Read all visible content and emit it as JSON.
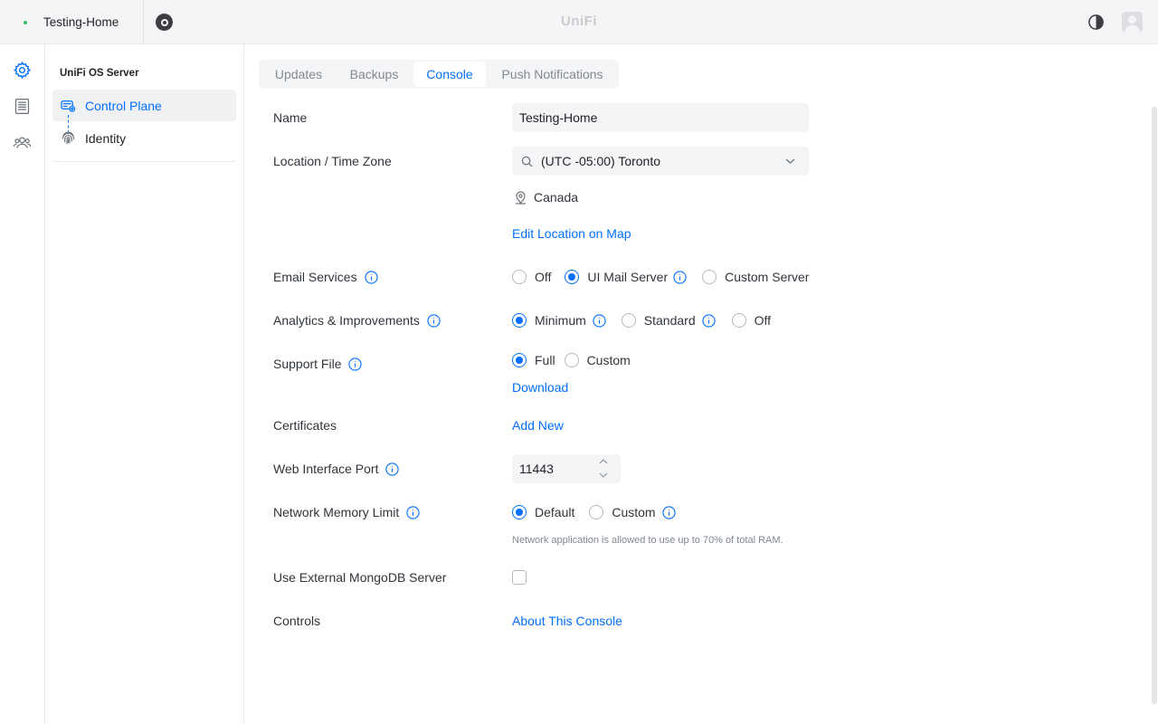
{
  "topbar": {
    "host_name": "Testing-Home",
    "logo": "UniFi",
    "status_color": "#36c26a"
  },
  "rail": {
    "items": [
      {
        "icon": "gear-icon",
        "active": true
      },
      {
        "icon": "list-icon",
        "active": false
      },
      {
        "icon": "users-icon",
        "active": false
      }
    ]
  },
  "sidebar": {
    "title": "UniFi OS Server",
    "items": [
      {
        "label": "Control Plane",
        "icon": "control-plane-icon",
        "active": true
      },
      {
        "label": "Identity",
        "icon": "fingerprint-icon",
        "active": false
      }
    ]
  },
  "tabs": [
    {
      "label": "Updates",
      "active": false
    },
    {
      "label": "Backups",
      "active": false
    },
    {
      "label": "Console",
      "active": true
    },
    {
      "label": "Push Notifications",
      "active": false
    }
  ],
  "form": {
    "name": {
      "label": "Name",
      "value": "Testing-Home"
    },
    "location": {
      "label": "Location / Time Zone",
      "value": "(UTC -05:00) Toronto",
      "country": "Canada",
      "edit_link": "Edit Location on Map"
    },
    "email": {
      "label": "Email Services",
      "options": [
        "Off",
        "UI Mail Server",
        "Custom Server"
      ],
      "selected": "UI Mail Server"
    },
    "analytics": {
      "label": "Analytics & Improvements",
      "options": [
        "Minimum",
        "Standard",
        "Off"
      ],
      "selected": "Minimum"
    },
    "support_file": {
      "label": "Support File",
      "options": [
        "Full",
        "Custom"
      ],
      "selected": "Full",
      "download": "Download"
    },
    "certificates": {
      "label": "Certificates",
      "add_new": "Add New"
    },
    "web_port": {
      "label": "Web Interface Port",
      "value": "11443"
    },
    "memory_limit": {
      "label": "Network Memory Limit",
      "options": [
        "Default",
        "Custom"
      ],
      "selected": "Default",
      "note": "Network application is allowed to use up to 70% of total RAM."
    },
    "mongodb": {
      "label": "Use External MongoDB Server",
      "checked": false
    },
    "controls": {
      "label": "Controls",
      "link": "About This Console"
    }
  },
  "colors": {
    "accent": "#006fff",
    "text": "#212327",
    "muted": "#808893",
    "surface": "#f4f5f6"
  }
}
